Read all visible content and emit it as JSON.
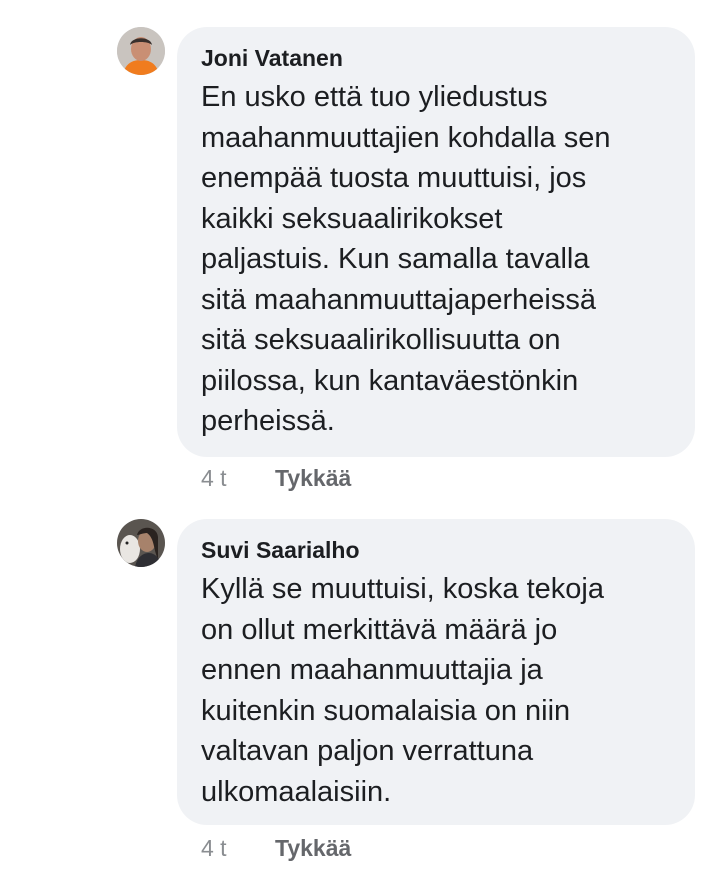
{
  "comments": [
    {
      "author": "Joni Vatanen",
      "text": "En usko että tuo yliedustus\nmaahanmuuttajien kohdalla sen\nenempää tuosta muuttuisi, jos\nkaikki seksuaalirikokset\npaljastuis. Kun samalla tavalla\nsitä maahanmuuttajaperheissä\nsitä seksuaalirikollisuutta on\npiilossa, kun kantaväestönkin\nperheissä.",
      "time": "4 t",
      "like_label": "Tykkää",
      "avatar_icon": "profile-photo-icon"
    },
    {
      "author": "Suvi Saarialho",
      "text": "Kyllä se muuttuisi, koska tekoja\non ollut merkittävä määrä jo\nennen maahanmuuttajia ja\nkuitenkin suomalaisia on niin\nvaltavan paljon verrattuna\nulkomaalaisiin.",
      "time": "4 t",
      "like_label": "Tykkää",
      "avatar_icon": "profile-photo-icon"
    }
  ],
  "colors": {
    "bubble_bg": "#f0f2f5",
    "text": "#1c1e21",
    "meta": "#8a8d91",
    "like": "#65676b"
  }
}
